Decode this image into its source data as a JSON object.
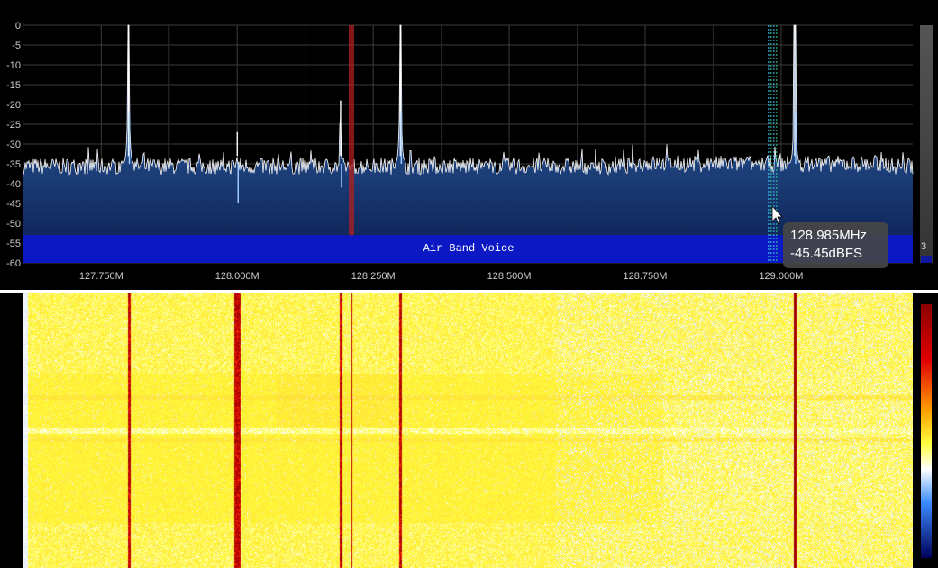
{
  "chart_data": {
    "type": "line",
    "title": "",
    "xlabel": "",
    "ylabel": "",
    "x_ticks": [
      "127.750M",
      "128.000M",
      "128.250M",
      "128.500M",
      "128.750M",
      "129.000M"
    ],
    "x_tick_values_mhz": [
      127.75,
      128.0,
      128.25,
      128.5,
      128.75,
      129.0
    ],
    "x_range_mhz": [
      127.607,
      129.242
    ],
    "y_ticks": [
      "0",
      "-5",
      "-10",
      "-15",
      "-20",
      "-25",
      "-30",
      "-35",
      "-40",
      "-45",
      "-50",
      "-55",
      "-60"
    ],
    "y_range_dbfs": [
      -60,
      0
    ],
    "grid": true,
    "noise_floor_dbfs": -35,
    "peaks": [
      {
        "freq_mhz": 127.8,
        "level_dbfs": 0
      },
      {
        "freq_mhz": 128.0,
        "level_dbfs": -27
      },
      {
        "freq_mhz": 128.19,
        "level_dbfs": -19
      },
      {
        "freq_mhz": 128.3,
        "level_dbfs": 0
      },
      {
        "freq_mhz": 129.025,
        "level_dbfs": 0
      }
    ],
    "markers": [
      {
        "freq_mhz": 128.21,
        "type": "vfo-red"
      },
      {
        "freq_mhz": 128.985,
        "type": "cursor-dashed"
      }
    ]
  },
  "band_plan": {
    "label": "Air Band Voice"
  },
  "cursor_tooltip": {
    "frequency": "128.985MHz",
    "level": "-45.45dBFS"
  },
  "fft_gain_slider": {
    "value": "3"
  },
  "colors": {
    "spectrum_fill_top": "#3a6fae",
    "spectrum_fill_bottom": "#0a1f55",
    "band_strip": "#0c18c4",
    "grid": "#444444",
    "vfo": "#a02020"
  }
}
